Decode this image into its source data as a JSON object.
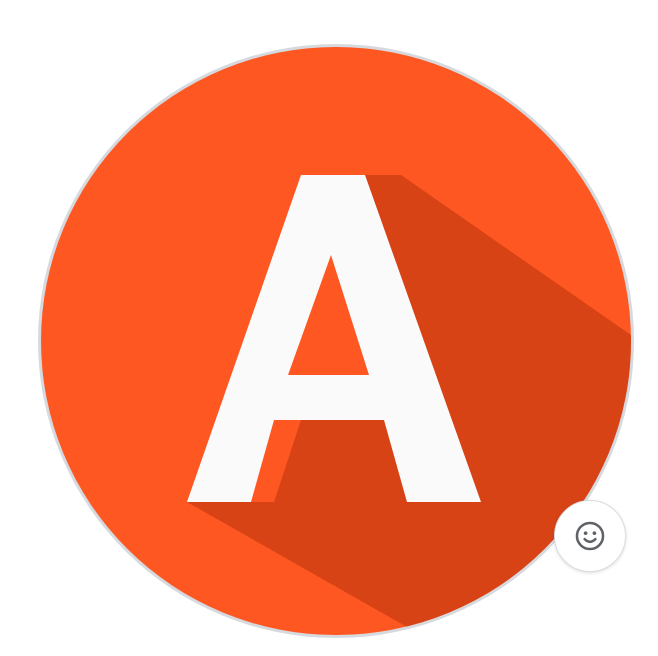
{
  "avatar": {
    "initial": "A",
    "background_color": "#FF5722",
    "shadow_color": "#D84315",
    "letter_color": "#FAFAFA",
    "border_color": "#D6DADE"
  },
  "emoji_button": {
    "icon": "smiley-face-icon"
  }
}
